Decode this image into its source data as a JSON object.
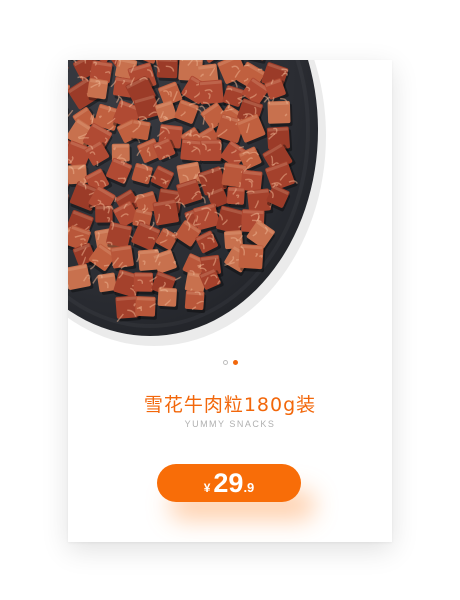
{
  "product": {
    "name": "雪花牛肉粒180g装",
    "subtitle": "YUMMY SNACKS",
    "image_icon": "beef-cubes-on-plate-image"
  },
  "carousel": {
    "total_slides": 2,
    "active_index": 1
  },
  "price": {
    "currency": "¥",
    "integer": "29",
    "decimal": ".9"
  },
  "colors": {
    "accent": "#f2670b",
    "button": "#f86d08",
    "plate": "#2b2d33",
    "meat": "#b5523a"
  }
}
